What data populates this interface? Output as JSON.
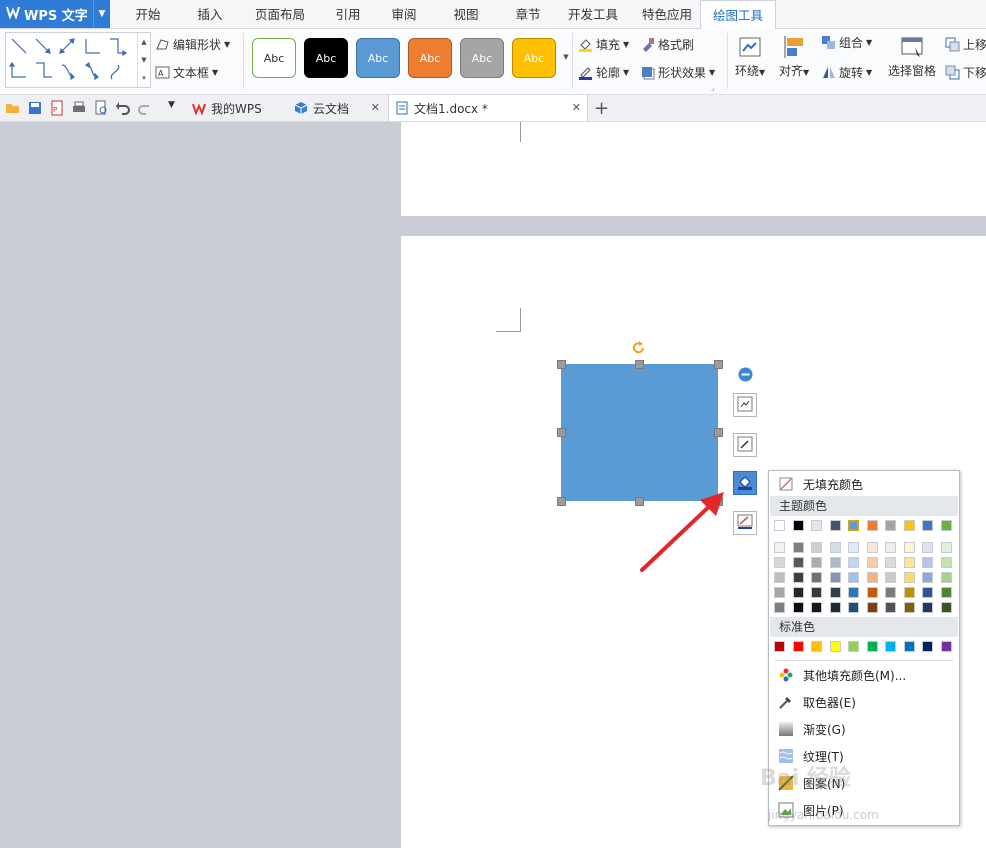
{
  "app": {
    "name": "WPS 文字"
  },
  "menu_tabs": [
    "开始",
    "插入",
    "页面布局",
    "引用",
    "审阅",
    "视图",
    "章节",
    "开发工具",
    "特色应用",
    "绘图工具"
  ],
  "active_tab": "绘图工具",
  "ribbon": {
    "edit_shape": "编辑形状",
    "text_box": "文本框",
    "style_label": "Abc",
    "fill": "填充",
    "format_painter": "格式刷",
    "outline": "轮廓",
    "shape_effects": "形状效果",
    "wrap": "环绕",
    "align": "对齐",
    "group": "组合",
    "rotate": "旋转",
    "selection_pane": "选择窗格",
    "bring_forward": "上移",
    "send_backward": "下移"
  },
  "style_swatches": [
    {
      "bg": "#ffffff",
      "border": "#70ad47",
      "fg": "#333333"
    },
    {
      "bg": "#000000",
      "border": "#000000",
      "fg": "#ffffff"
    },
    {
      "bg": "#5b9bd5",
      "border": "#41719c",
      "fg": "#ffffff"
    },
    {
      "bg": "#ed7d31",
      "border": "#ae5a21",
      "fg": "#ffffff"
    },
    {
      "bg": "#a5a5a5",
      "border": "#7c7c7c",
      "fg": "#ffffff"
    },
    {
      "bg": "#ffc000",
      "border": "#bc8c00",
      "fg": "#ffffff"
    }
  ],
  "doc_tabs": [
    {
      "label": "我的WPS",
      "icon": "wps-logo-icon"
    },
    {
      "label": "云文档",
      "icon": "cloud-box-icon"
    },
    {
      "label": "文档1.docx *",
      "icon": "document-icon"
    }
  ],
  "fill_menu": {
    "no_fill": "无填充颜色",
    "theme_colors": "主题颜色",
    "standard_colors": "标准色",
    "more_colors": "其他填充颜色(M)...",
    "eyedropper": "取色器(E)",
    "gradient": "渐变(G)",
    "texture": "纹理(T)",
    "pattern": "图案(N)",
    "picture": "图片(P)"
  },
  "theme_top_row": [
    "#ffffff",
    "#000000",
    "#e7e6e6",
    "#44546a",
    "#5b9bd5",
    "#ed7d31",
    "#a5a5a5",
    "#ffc000",
    "#4472c4",
    "#70ad47"
  ],
  "theme_shades": [
    [
      "#f2f2f2",
      "#7f7f7f",
      "#d0cece",
      "#d6dce4",
      "#deebf6",
      "#fbe5d5",
      "#ededed",
      "#fff2cc",
      "#dae3f3",
      "#e2efd9"
    ],
    [
      "#d8d8d8",
      "#595959",
      "#aeabab",
      "#adb9ca",
      "#bdd7ee",
      "#f7cbac",
      "#dbdbdb",
      "#fee599",
      "#b4c6e7",
      "#c5e0b3"
    ],
    [
      "#bfbfbf",
      "#3f3f3f",
      "#757070",
      "#8496b0",
      "#9cc3e5",
      "#f4b183",
      "#c9c9c9",
      "#ffd965",
      "#8eaadb",
      "#a8d08d"
    ],
    [
      "#a5a5a5",
      "#262626",
      "#3a3838",
      "#323f4f",
      "#2e75b5",
      "#c55a11",
      "#7b7b7b",
      "#bf9000",
      "#2f5496",
      "#538135"
    ],
    [
      "#7f7f7f",
      "#0c0c0c",
      "#171616",
      "#222a35",
      "#1e4e79",
      "#833c0b",
      "#525252",
      "#7f6000",
      "#1f3864",
      "#375623"
    ]
  ],
  "standard_colors": [
    "#c00000",
    "#ff0000",
    "#ffc000",
    "#ffff00",
    "#92d050",
    "#00b050",
    "#00b0f0",
    "#0070c0",
    "#002060",
    "#7030a0"
  ],
  "shape_fill_color": "#5b9bd5",
  "watermark": "Bai 经验",
  "watermark_url": "jingyan.baidu.com"
}
